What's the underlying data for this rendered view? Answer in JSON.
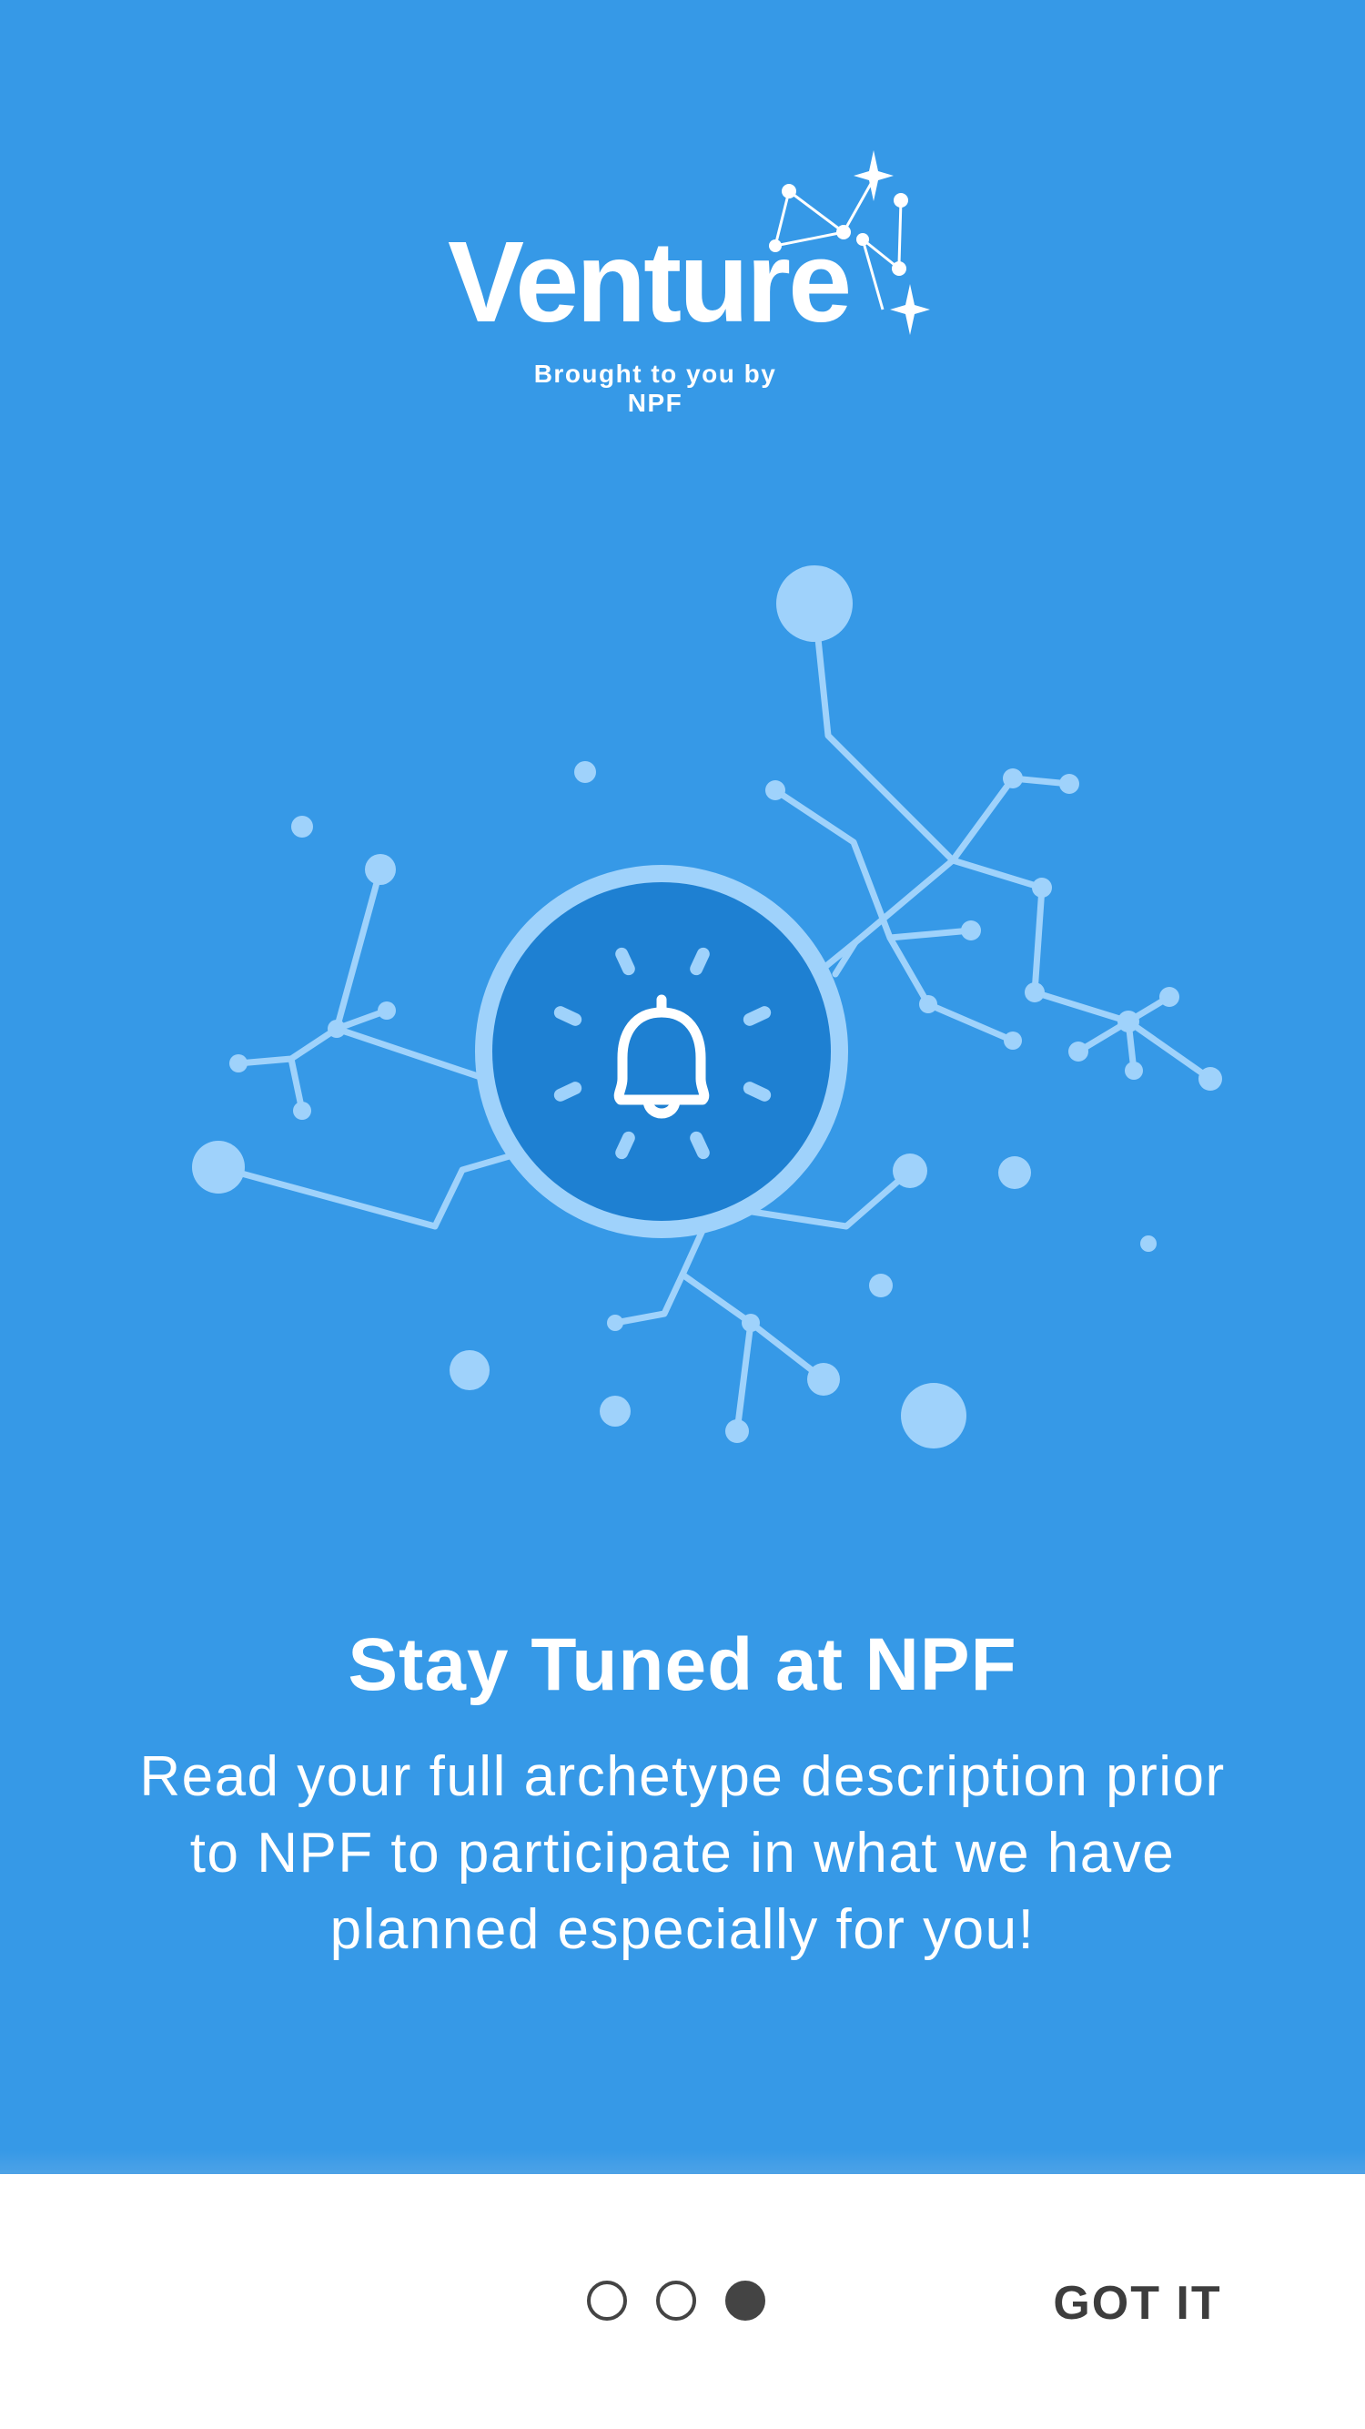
{
  "app": {
    "logo_text": "Venture",
    "tagline": "Brought to you by NPF"
  },
  "slide": {
    "title": "Stay Tuned at NPF",
    "body": "Read your full archetype description prior to NPF to participate in what we have planned especially for you!",
    "illustration_icon": "bell-icon"
  },
  "pager": {
    "total": 3,
    "active_index": 3
  },
  "actions": {
    "done_label": "GOT IT"
  },
  "colors": {
    "background": "#3699e7",
    "circle_inner": "#1e80d2",
    "constellation": "#9fd2fb",
    "footer": "#ffffff",
    "footer_text": "#3d3d3d"
  }
}
